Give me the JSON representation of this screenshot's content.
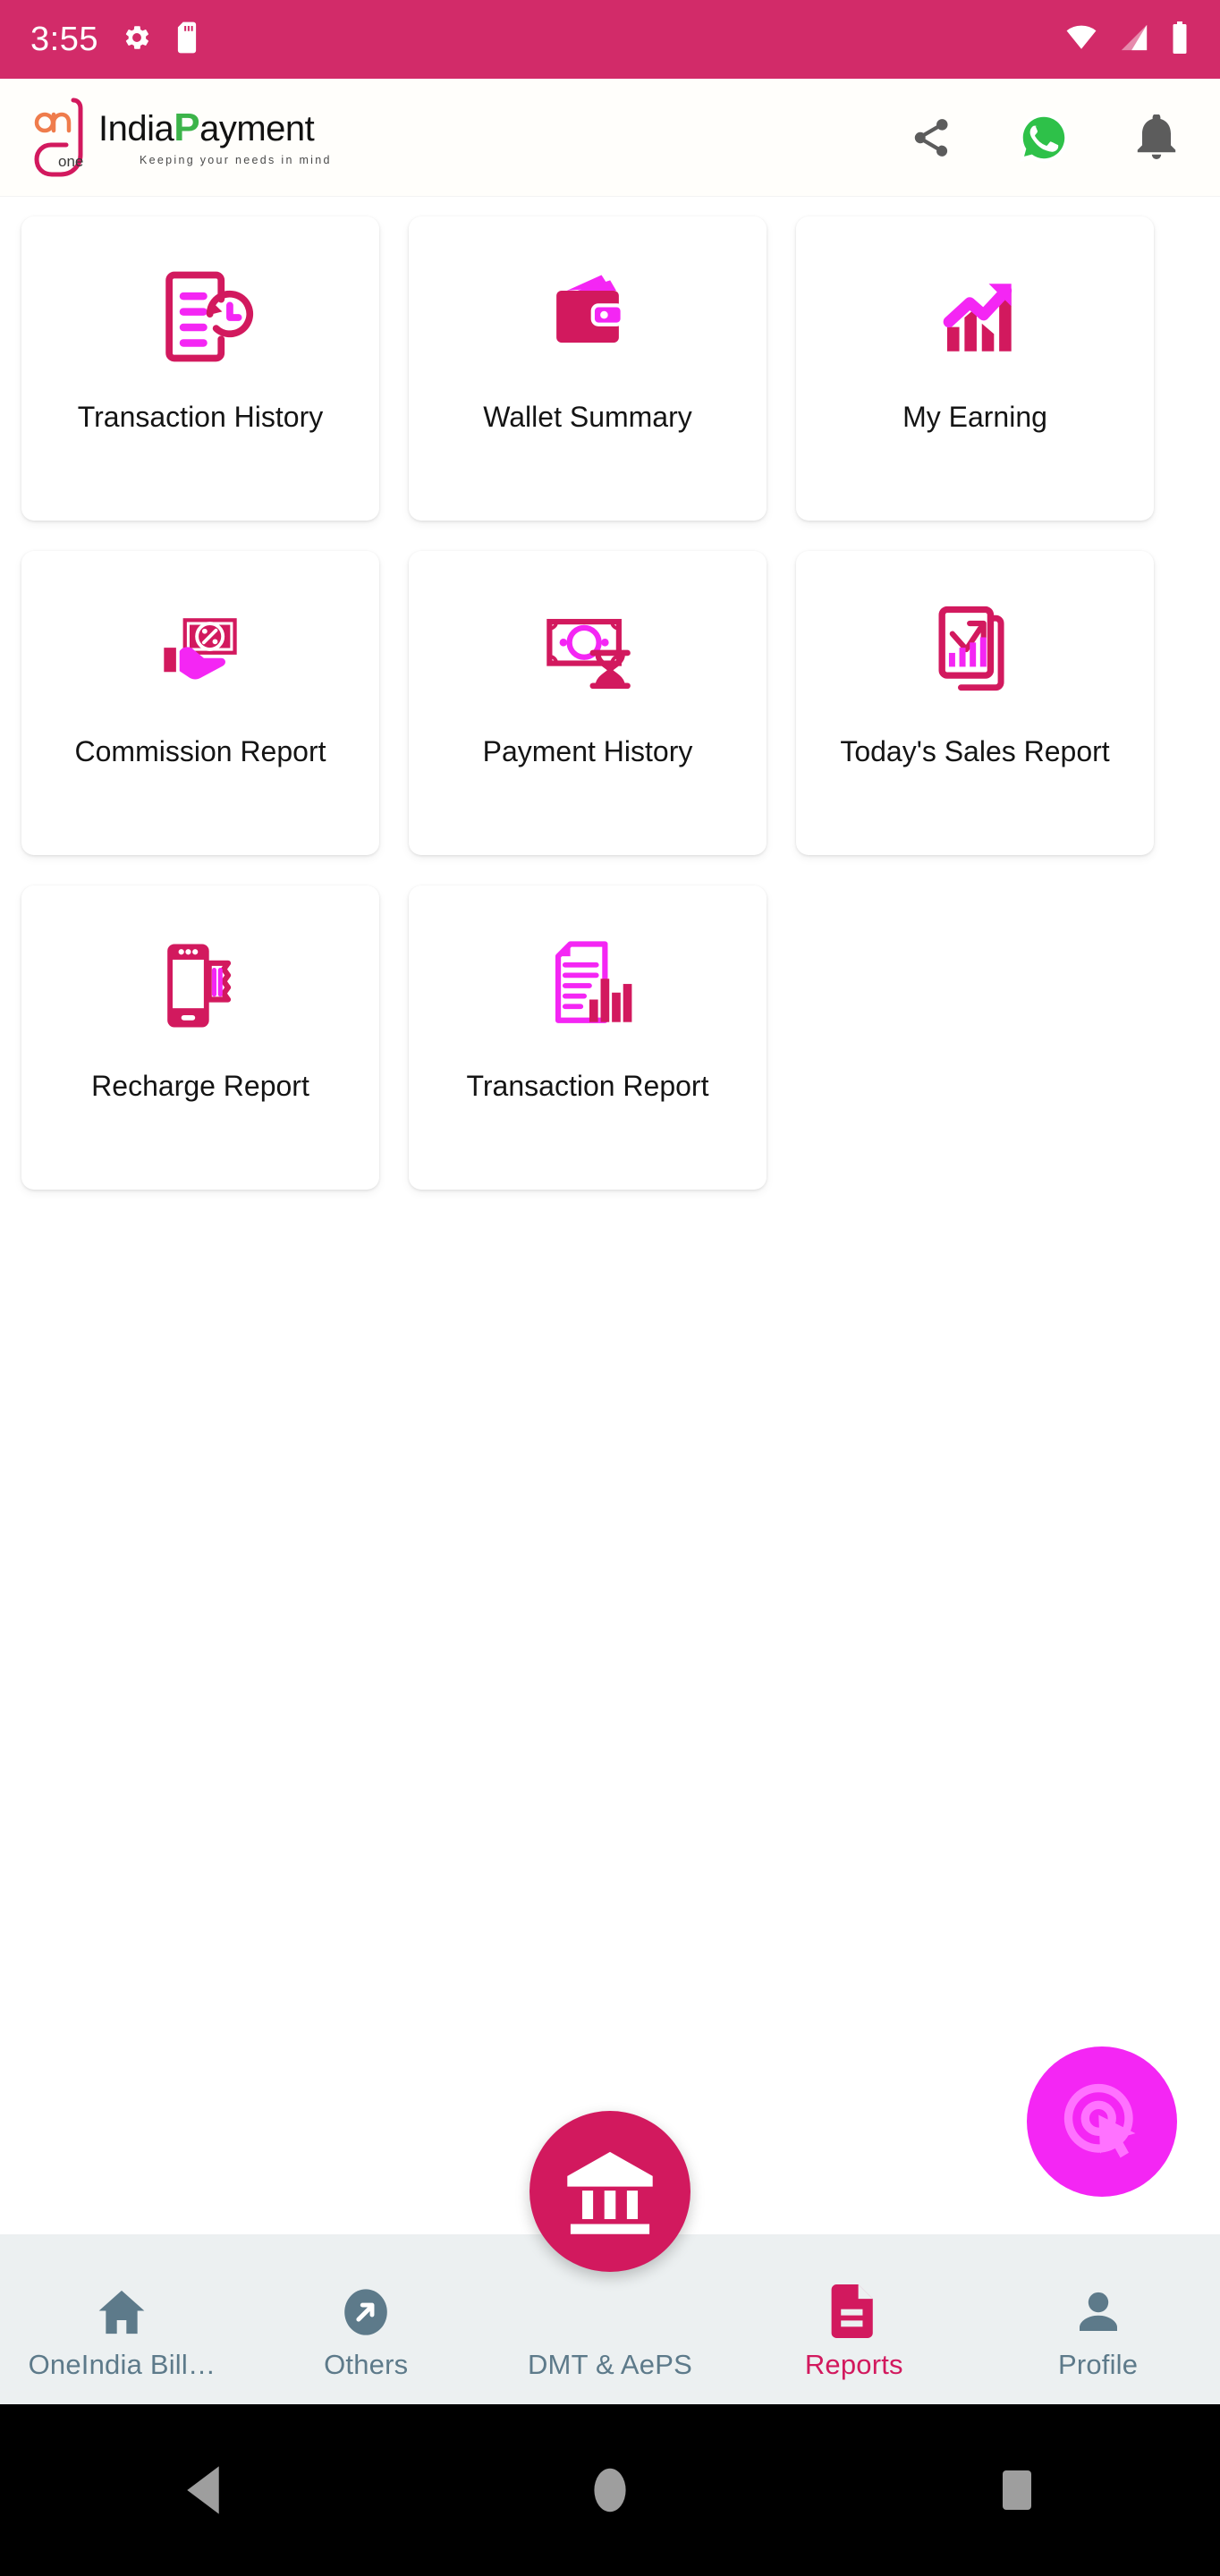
{
  "status_bar": {
    "time": "3:55",
    "background_color": "#d22b69",
    "left_icons": [
      {
        "name": "settings-gear-icon"
      },
      {
        "name": "sd-card-icon"
      }
    ],
    "right_icons": [
      {
        "name": "wifi-icon"
      },
      {
        "name": "cellular-signal-icon"
      },
      {
        "name": "battery-icon"
      }
    ]
  },
  "header": {
    "logo": {
      "mark_text": "one",
      "word_one": "India",
      "word_p": "P",
      "word_rest": "ayment",
      "tagline": "Keeping your needs in mind",
      "brand_green": "#3cb44a",
      "brand_pink": "#d2195e",
      "brand_orange": "#ef7c4c"
    },
    "actions": [
      {
        "name": "share-icon",
        "label": "Share"
      },
      {
        "name": "whatsapp-icon",
        "label": "WhatsApp"
      },
      {
        "name": "notification-bell-icon",
        "label": "Notifications"
      }
    ]
  },
  "colors": {
    "primary": "#d2195e",
    "accent_magenta": "#f426f4",
    "status_bar": "#d22b69",
    "nav_background": "#ecf0f1",
    "nav_inactive": "#5d7a8a",
    "card_background": "#ffffff",
    "page_background": "#ffffff"
  },
  "grid": {
    "tiles": [
      {
        "id": "transaction-history",
        "label": "Transaction History",
        "icon": "document-history-icon"
      },
      {
        "id": "wallet-summary",
        "label": "Wallet Summary",
        "icon": "wallet-icon"
      },
      {
        "id": "my-earning",
        "label": "My Earning",
        "icon": "growth-chart-arrow-icon"
      },
      {
        "id": "commission-report",
        "label": "Commission Report",
        "icon": "hand-percent-money-icon"
      },
      {
        "id": "payment-history",
        "label": "Payment History",
        "icon": "banknote-hourglass-icon"
      },
      {
        "id": "todays-sales-report",
        "label": "Today's Sales Report",
        "icon": "documents-bar-arrow-icon"
      },
      {
        "id": "recharge-report",
        "label": "Recharge Report",
        "icon": "phone-receipt-icon"
      },
      {
        "id": "transaction-report",
        "label": "Transaction Report",
        "icon": "document-bars-icon"
      }
    ]
  },
  "bottom_nav": {
    "items": [
      {
        "id": "oneindia-bill",
        "label": "OneIndia Bill…",
        "icon": "home-icon",
        "active": false
      },
      {
        "id": "others",
        "label": "Others",
        "icon": "arrow-circle-icon",
        "active": false
      },
      {
        "id": "dmt-aeps",
        "label": "DMT & AePS",
        "icon": "bank-icon",
        "active": false
      },
      {
        "id": "reports",
        "label": "Reports",
        "icon": "report-file-icon",
        "active": true
      },
      {
        "id": "profile",
        "label": "Profile",
        "icon": "person-icon",
        "active": false
      }
    ],
    "fab": {
      "id": "dmt-aeps-fab",
      "icon": "bank-icon"
    }
  },
  "overlay": {
    "touch_indicator": {
      "name": "touch-pointer-bubble",
      "icon": "tap-cursor-icon"
    }
  },
  "system_nav": {
    "buttons": [
      {
        "name": "back-button",
        "icon": "triangle-back-icon"
      },
      {
        "name": "home-button",
        "icon": "circle-home-icon"
      },
      {
        "name": "recents-button",
        "icon": "square-recents-icon"
      }
    ]
  }
}
